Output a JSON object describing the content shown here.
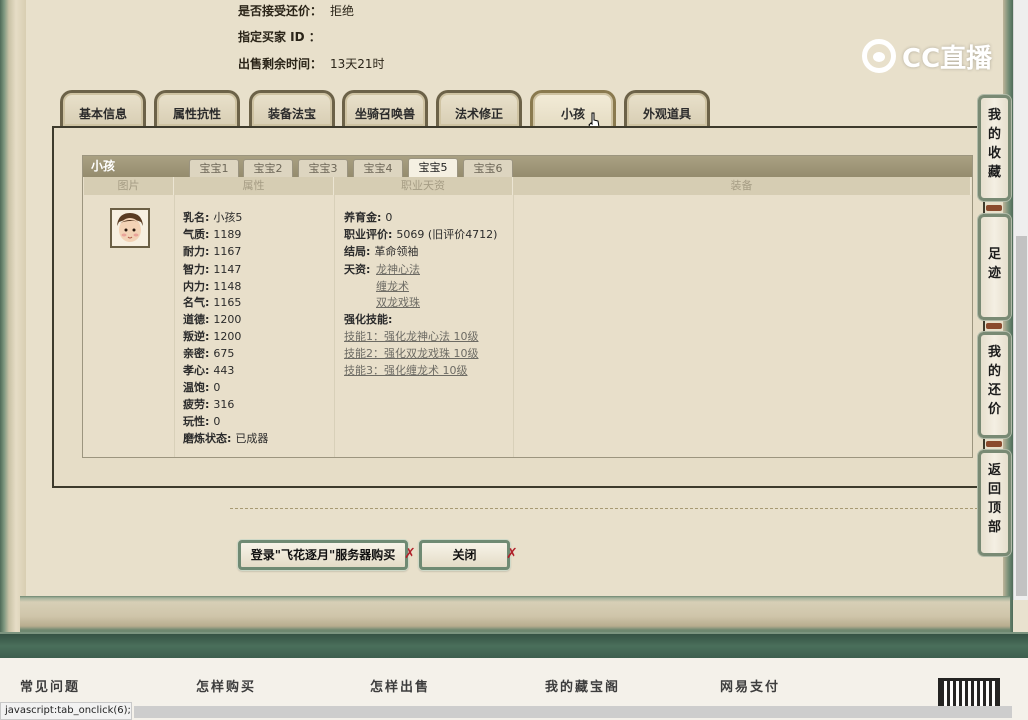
{
  "top_info": [
    {
      "label": "是否接受还价：",
      "value": "拒绝"
    },
    {
      "label": "指定买家 ID ：",
      "value": ""
    },
    {
      "label": "出售剩余时间：",
      "value": "13天21时"
    }
  ],
  "logo_text": "CC直播",
  "tabs": [
    "基本信息",
    "属性抗性",
    "装备法宝",
    "坐骑召唤兽",
    "法术修正",
    "小孩",
    "外观道具"
  ],
  "active_tab": "小孩",
  "panel": {
    "title": "小孩",
    "subtabs": [
      "宝宝1",
      "宝宝2",
      "宝宝3",
      "宝宝4",
      "宝宝5",
      "宝宝6"
    ],
    "active_subtab": "宝宝5",
    "columns": [
      "图片",
      "属性",
      "职业天资",
      "装备"
    ],
    "avatar_icon": "child-portrait-icon",
    "attributes": [
      {
        "k": "乳名:",
        "v": "小孩5"
      },
      {
        "k": "气质:",
        "v": "1189"
      },
      {
        "k": "耐力:",
        "v": "1167"
      },
      {
        "k": "智力:",
        "v": "1147"
      },
      {
        "k": "内力:",
        "v": "1148"
      },
      {
        "k": "名气:",
        "v": "1165"
      },
      {
        "k": "道德:",
        "v": "1200"
      },
      {
        "k": "叛逆:",
        "v": "1200"
      },
      {
        "k": "亲密:",
        "v": "675"
      },
      {
        "k": "孝心:",
        "v": "443"
      },
      {
        "k": "温饱:",
        "v": "0"
      },
      {
        "k": "疲劳:",
        "v": "316"
      },
      {
        "k": "玩性:",
        "v": "0"
      },
      {
        "k": "磨炼状态:",
        "v": "已成器"
      }
    ],
    "career": {
      "raise_money": {
        "k": "养育金:",
        "v": "0"
      },
      "rating": {
        "k": "职业评价:",
        "v": "5069 (旧评价4712)"
      },
      "ending": {
        "k": "结局:",
        "v": "革命领袖"
      },
      "talent_label": "天资:",
      "talents": [
        "龙神心法",
        "缠龙术",
        "双龙戏珠"
      ],
      "skills_label": "强化技能:",
      "skills": [
        "技能1：强化龙神心法 10级",
        "技能2：强化双龙戏珠 10级",
        "技能3：强化缠龙术 10级"
      ]
    }
  },
  "buttons": {
    "login": "登录\"飞花逐月\"服务器购买",
    "close": "关闭"
  },
  "side_widgets": [
    "我的收藏",
    "足迹",
    "我的还价",
    "返回顶部"
  ],
  "footer_links": [
    "常见问题",
    "怎样购买",
    "怎样出售",
    "我的藏宝阁",
    "网易支付"
  ],
  "status_bar": "javascript:tab_onclick(6);",
  "colors": {
    "accent_green": "#4a6f5b",
    "frame_brown": "#6c6248",
    "close_x": "#b0202a"
  }
}
